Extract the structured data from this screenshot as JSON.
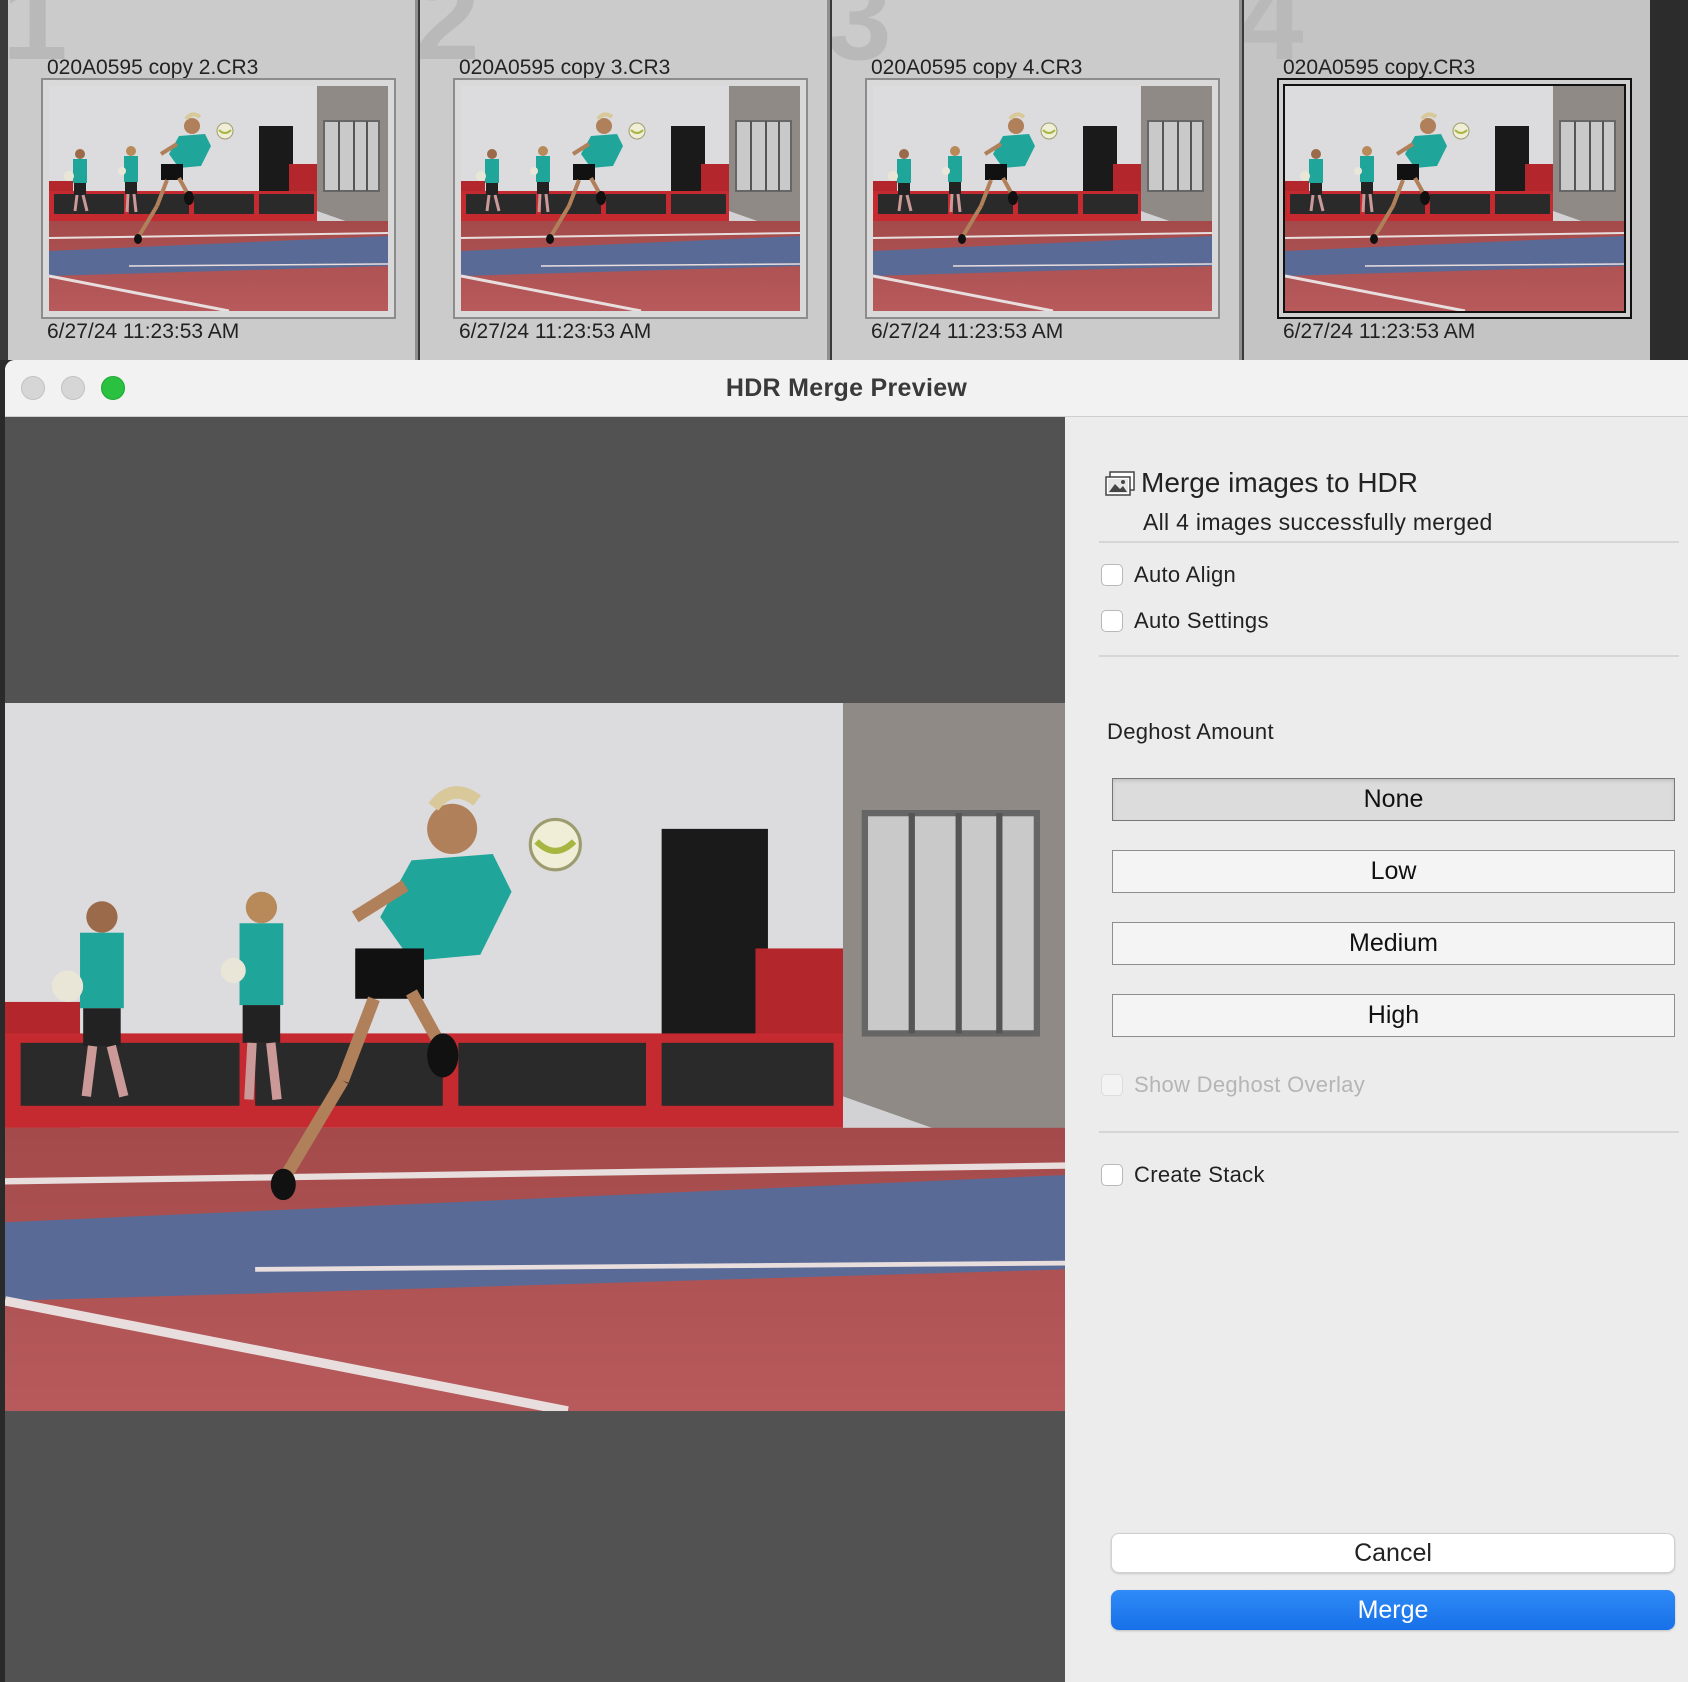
{
  "filmstrip": {
    "items": [
      {
        "index": "1",
        "name": "020A0595 copy 2.CR3",
        "date": "6/27/24 11:23:53 AM",
        "selected": false
      },
      {
        "index": "2",
        "name": "020A0595 copy 3.CR3",
        "date": "6/27/24 11:23:53 AM",
        "selected": false
      },
      {
        "index": "3",
        "name": "020A0595 copy 4.CR3",
        "date": "6/27/24 11:23:53 AM",
        "selected": false
      },
      {
        "index": "4",
        "name": "020A0595 copy.CR3",
        "date": "6/27/24 11:23:53 AM",
        "selected": true
      }
    ]
  },
  "dialog": {
    "title": "HDR Merge Preview"
  },
  "panel": {
    "icon": "photo-stack-icon",
    "title": "Merge images to HDR",
    "subtitle": "All 4 images successfully merged",
    "auto_align": {
      "label": "Auto Align",
      "checked": false
    },
    "auto_settings": {
      "label": "Auto Settings",
      "checked": false
    },
    "deghost_label": "Deghost Amount",
    "deghost_options": [
      "None",
      "Low",
      "Medium",
      "High"
    ],
    "deghost_selected": "None",
    "show_overlay": {
      "label": "Show Deghost Overlay",
      "checked": false,
      "disabled": true
    },
    "create_stack": {
      "label": "Create Stack",
      "checked": false
    },
    "cancel_label": "Cancel",
    "merge_label": "Merge"
  },
  "colors": {
    "accent": "#1a74ea",
    "close": "#d6d6d6",
    "maximize": "#29c13f"
  }
}
